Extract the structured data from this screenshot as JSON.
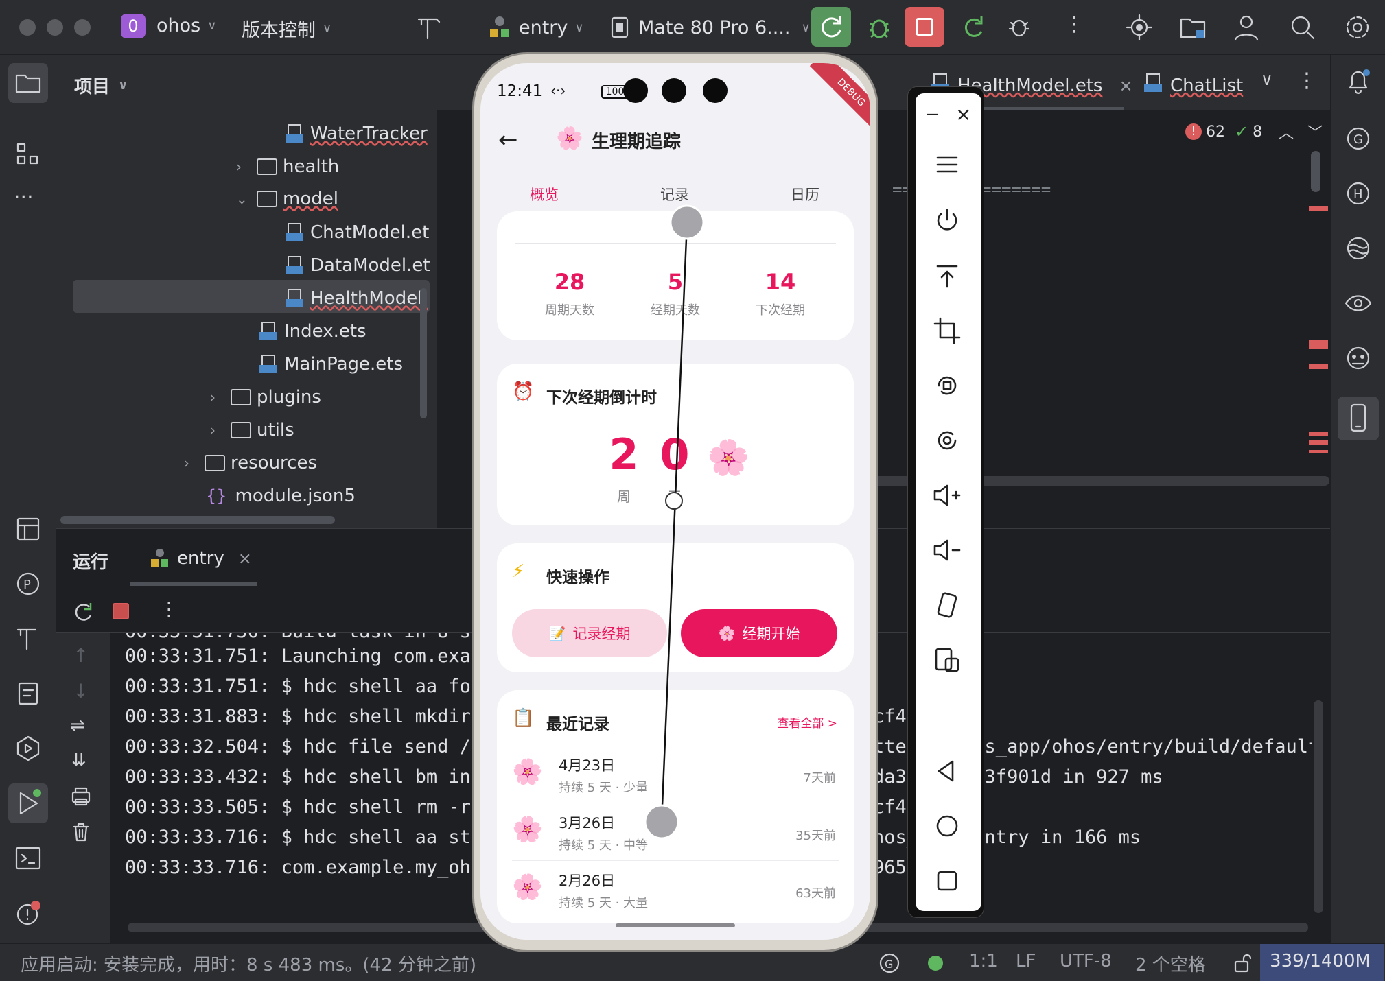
{
  "toolbar": {
    "project_badge": "0",
    "project_name": "ohos",
    "vcs_label": "版本控制",
    "run_config": "entry",
    "device": "Mate 80 Pro 6...."
  },
  "project_panel": {
    "title": "项目",
    "items": [
      {
        "label": "WaterTracker",
        "kind": "ets"
      },
      {
        "label": "health",
        "kind": "folder"
      },
      {
        "label": "model",
        "kind": "folder"
      },
      {
        "label": "ChatModel.et",
        "kind": "ets"
      },
      {
        "label": "DataModel.et",
        "kind": "ets"
      },
      {
        "label": "HealthModel.",
        "kind": "ets"
      },
      {
        "label": "Index.ets",
        "kind": "ets"
      },
      {
        "label": "MainPage.ets",
        "kind": "ets"
      },
      {
        "label": "plugins",
        "kind": "folder"
      },
      {
        "label": "utils",
        "kind": "folder"
      },
      {
        "label": "resources",
        "kind": "folder"
      },
      {
        "label": "module.json5",
        "kind": "json"
      }
    ]
  },
  "editor": {
    "tabs": [
      "HealthModel.ets",
      "ChatList"
    ],
    "errors": "62",
    "warnings": "8",
    "code_fragment": "==  ============"
  },
  "run_panel": {
    "title": "运行",
    "tab": "entry",
    "logs": [
      "00:33:31.750: Build task in 8 s",
      "00:33:31.751: Launching com.examp",
      "00:33:31.751: $ hdc shell aa forc",
      "00:33:31.883: $ hdc shell mkdir ",
      "00:33:32.504: $ hdc file send /Us",
      "00:33:33.432: $ hdc shell bm inst",
      "00:33:33.505: $ hdc shell rm -rf ",
      "00:33:33.716: $ hdc shell aa star",
      "00:33:33.716: com.example.my_ohos"
    ],
    "logs_right": [
      "",
      "",
      "",
      "cf473",
      "tter     os_app/ohos/entry/build/default",
      "da31     73f901d in 927 ms",
      "cf47",
      "hos_     entry in 166 ms",
      "965"
    ]
  },
  "status_bar": {
    "message": "应用启动: 安装完成，用时：8 s 483 ms。(42 分钟之前)",
    "position": "1:1",
    "line_sep": "LF",
    "encoding": "UTF-8",
    "indent": "2 个空格",
    "memory": "339/1400M"
  },
  "phone": {
    "time": "12:41",
    "battery": "100",
    "debug_ribbon": "DEBUG",
    "page_title": "生理期追踪",
    "tabs": [
      "概览",
      "记录",
      "日历"
    ],
    "active_tab": 0,
    "stats": [
      {
        "value": "28",
        "label": "周期天数"
      },
      {
        "value": "5",
        "label": "经期天数"
      },
      {
        "value": "14",
        "label": "下次经期"
      }
    ],
    "countdown": {
      "title": "下次经期倒计时",
      "digits": [
        "2",
        "0"
      ],
      "units": [
        "周",
        "天"
      ]
    },
    "quick_actions": {
      "title": "快速操作",
      "record_button": "记录经期",
      "start_button": "经期开始"
    },
    "recent": {
      "title": "最近记录",
      "view_all": "查看全部 >",
      "items": [
        {
          "date": "4月23日",
          "detail": "持续 5 天 · 少量",
          "ago": "7天前"
        },
        {
          "date": "3月26日",
          "detail": "持续 5 天 · 中等",
          "ago": "35天前"
        },
        {
          "date": "2月26日",
          "detail": "持续 5 天 · 大量",
          "ago": "63天前"
        }
      ]
    },
    "accent_color": "#e8175d"
  },
  "emulator_toolbar": {
    "buttons": [
      "menu-icon",
      "power-icon",
      "top-icon",
      "crop-icon",
      "rotate-left-icon",
      "rotate-right-icon",
      "volume-up-icon",
      "volume-down-icon",
      "shake-icon",
      "multi-device-icon",
      "back-icon",
      "home-icon",
      "recents-icon"
    ]
  }
}
